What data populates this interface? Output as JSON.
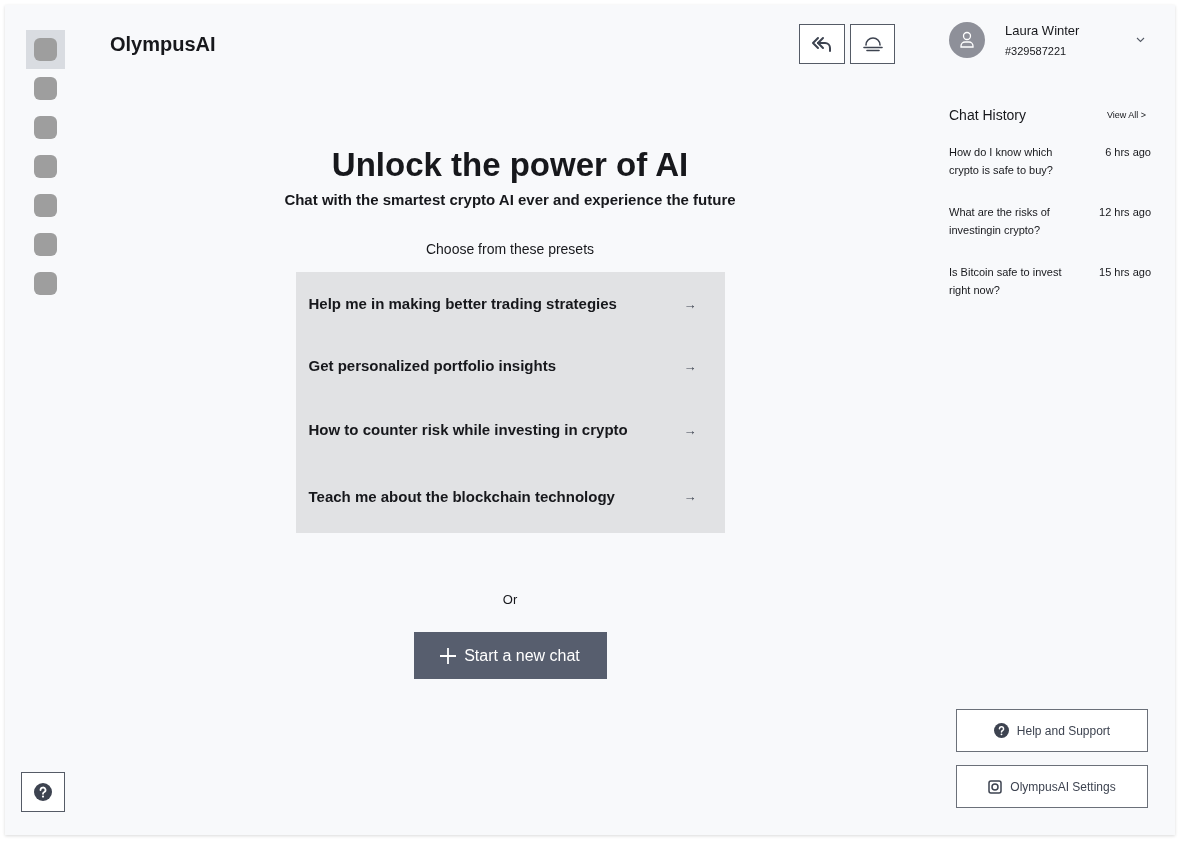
{
  "sidebar": {
    "items": [
      {
        "selected": true
      },
      {
        "selected": false
      },
      {
        "selected": false
      },
      {
        "selected": false
      },
      {
        "selected": false
      },
      {
        "selected": false
      },
      {
        "selected": false
      }
    ]
  },
  "logo": "OlympusAI",
  "user": {
    "name": "Laura Winter",
    "id": "#329587221"
  },
  "hero": {
    "title": "Unlock the power of AI",
    "subtitle": "Chat with the smartest crypto AI ever and experience the future",
    "presets_label": "Choose from these presets"
  },
  "presets": [
    {
      "label": "Help me in making better trading strategies",
      "arrow": "→"
    },
    {
      "label": "Get personalized portfolio insights",
      "arrow": "→"
    },
    {
      "label": "How to counter risk while investing in crypto",
      "arrow": "→"
    },
    {
      "label": "Teach me about the blockchain technology",
      "arrow": "→"
    }
  ],
  "or_text": "Or",
  "new_chat_button": "Start a new chat",
  "chat_history": {
    "title": "Chat History",
    "view_all": "View All >",
    "items": [
      {
        "question": "How do I know which crypto is safe to buy?",
        "time": "6 hrs ago"
      },
      {
        "question": "What are the risks of investingin crypto?",
        "time": "12 hrs ago"
      },
      {
        "question": "Is Bitcoin safe to invest right now?",
        "time": "15 hrs ago"
      }
    ]
  },
  "footer_buttons": [
    {
      "kind": "help",
      "label": "Help and Support"
    },
    {
      "kind": "settings",
      "label": "OlympusAI Settings"
    }
  ]
}
